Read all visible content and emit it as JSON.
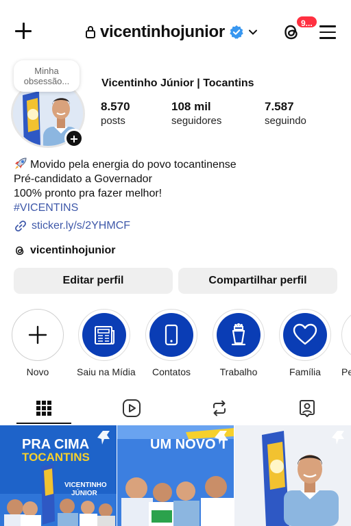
{
  "header": {
    "username": "vicentinhojunior",
    "threads_badge": "9...",
    "icons": {
      "new_post": "plus-icon",
      "lock": "lock-icon",
      "verified": "verified-badge-icon",
      "account_switch": "chevron-down-icon",
      "threads": "threads-icon",
      "menu": "hamburger-menu-icon"
    }
  },
  "profile": {
    "note": "Minha obsessão...",
    "display_name": "Vicentinho Júnior | Tocantins",
    "stats": [
      {
        "value": "8.570",
        "label": "posts"
      },
      {
        "value": "108 mil",
        "label": "seguidores"
      },
      {
        "value": "7.587",
        "label": "seguindo"
      }
    ],
    "bio": {
      "line1": "Movido pela energia do povo tocantinense",
      "line2": "Pré-candidato a Governador",
      "line3": "100% pronto pra fazer melhor!",
      "hashtag": "#VICENTINS"
    },
    "link": "sticker.ly/s/2YHMCF",
    "threads_handle": "vicentinhojunior"
  },
  "actions": {
    "edit": "Editar perfil",
    "share": "Compartilhar perfil"
  },
  "highlights": [
    {
      "label": "Novo",
      "icon": "plus-icon"
    },
    {
      "label": "Saiu na Mídia",
      "icon": "newspaper-icon"
    },
    {
      "label": "Contatos",
      "icon": "phone-icon"
    },
    {
      "label": "Trabalho",
      "icon": "podium-icon"
    },
    {
      "label": "Família",
      "icon": "heart-icon"
    },
    {
      "label": "Pe",
      "icon": "highlight-icon"
    }
  ],
  "tabs": [
    {
      "name": "grid",
      "icon": "grid-icon",
      "active": true
    },
    {
      "name": "reels",
      "icon": "reels-icon",
      "active": false
    },
    {
      "name": "reposts",
      "icon": "repost-icon",
      "active": false
    },
    {
      "name": "tagged",
      "icon": "tagged-icon",
      "active": false
    }
  ],
  "posts": [
    {
      "headline1": "PRA CIMA",
      "headline2": "TOCANTINS",
      "name1": "VICENTINHO",
      "name2": "JÚNIOR",
      "pinned": true
    },
    {
      "headline1": "UM NOVO T",
      "pinned": true
    },
    {
      "pinned": true
    }
  ],
  "colors": {
    "accent_blue": "#0a3db5",
    "link_blue": "#3e58a9",
    "badge_red": "#ff3040",
    "verified_blue": "#3897f0",
    "button_gray": "#efefef"
  }
}
